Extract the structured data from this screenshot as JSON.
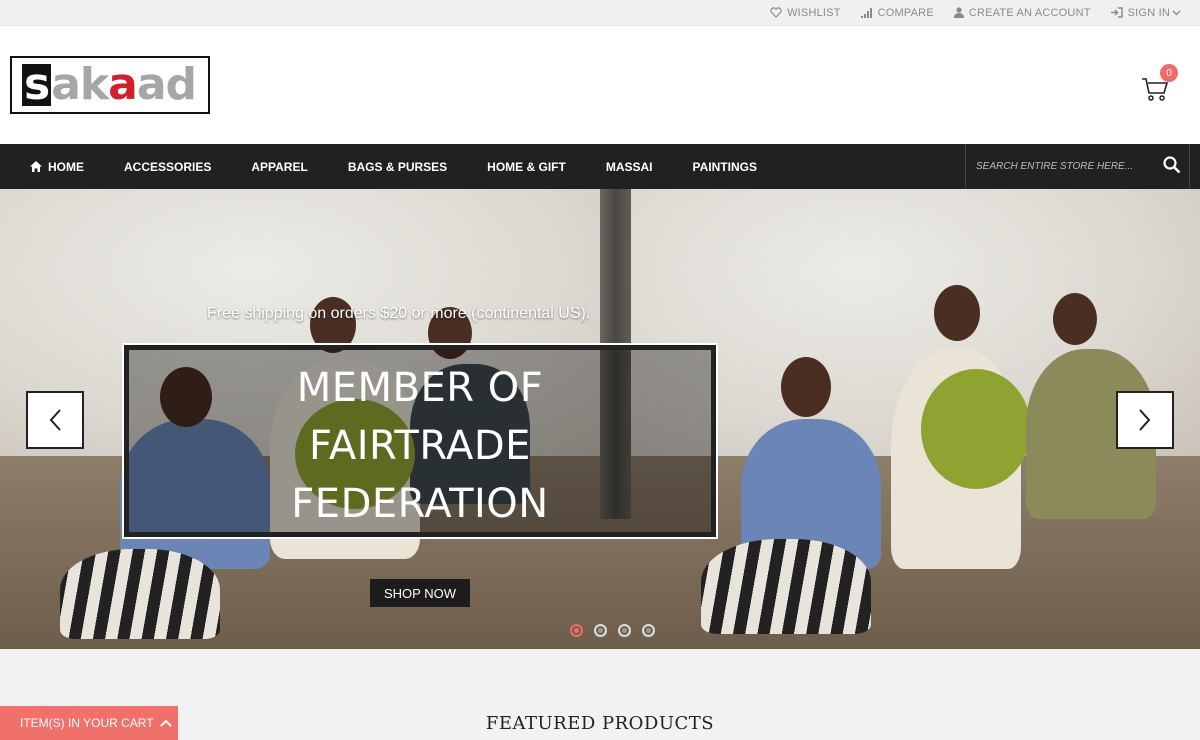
{
  "topbar": {
    "links": [
      {
        "label": "WISHLIST",
        "icon": "heart-icon"
      },
      {
        "label": "COMPARE",
        "icon": "signal-bars-icon"
      },
      {
        "label": "CREATE AN ACCOUNT",
        "icon": "user-icon"
      },
      {
        "label": "SIGN IN",
        "icon": "sign-in-icon"
      }
    ]
  },
  "header": {
    "logo": {
      "text": "sakaad"
    },
    "cart": {
      "count": "0",
      "icon": "cart-icon"
    }
  },
  "nav": {
    "items": [
      {
        "label": "HOME",
        "icon": "home-icon"
      },
      {
        "label": "ACCESSORIES"
      },
      {
        "label": "APPAREL"
      },
      {
        "label": "BAGS & PURSES"
      },
      {
        "label": "HOME & GIFT"
      },
      {
        "label": "MASSAI"
      },
      {
        "label": "PAINTINGS"
      }
    ],
    "search": {
      "placeholder": "SEARCH ENTIRE STORE HERE...",
      "icon": "search-icon"
    }
  },
  "hero": {
    "tagline": "Free shipping on orders $20 or more (continental US).",
    "headline_lines": [
      "MEMBER OF",
      "FAIRTRADE",
      "FEDERATION"
    ],
    "cta": "SHOP NOW",
    "slides": 4,
    "active_slide": 1
  },
  "footer_bar": {
    "cart_label": "ITEM(S) IN YOUR CART",
    "featured_title": "FEATURED PRODUCTS"
  },
  "colors": {
    "accent": "#ef6a6a",
    "nav_bg": "#212121",
    "logo_red": "#d3202e"
  }
}
